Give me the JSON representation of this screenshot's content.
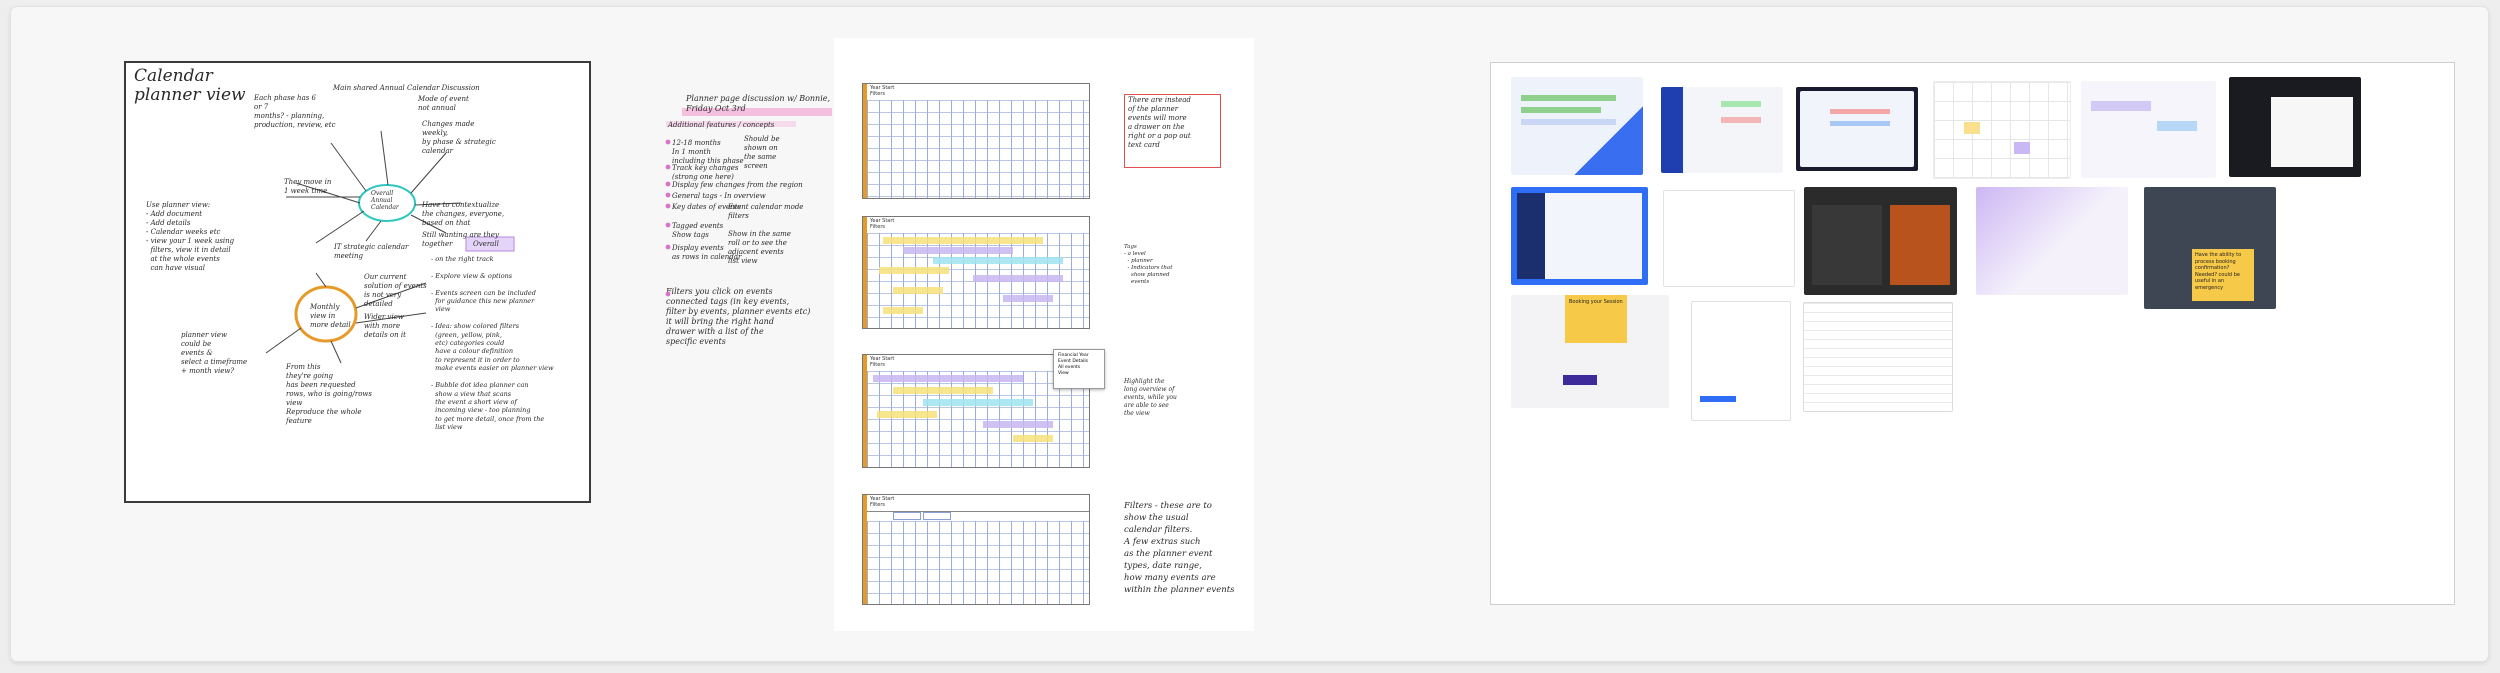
{
  "card1": {
    "title": "Calendar\nplanner view",
    "notes": [
      "Main shared Annual Calendar Discussion",
      "Each phase has 6\nor 7\nmonths? - planning,\nproduction, review, etc",
      "Mode of event\nnot annual",
      "Changes made\nweekly,\nby phase & strategic\ncalendar",
      "They move in\n1 week time",
      "Have to contextualize\nthe changes, everyone,\nbased on that",
      "Still wanting are they\ntogether",
      "Overall\nAnnual\nCalendar",
      "Use planner view:\n- Add document\n- Add details\n- Calendar weeks etc\n- view your 1 week using\n  filters, view it in detail\n  at the whole events\n  can have visual",
      "IT strategic calendar\nmeeting",
      "Monthly\nview in\nmore detail",
      "Our current\nsolution of events\nis not very\ndetailed",
      "Wider view\nwith more\ndetails on it",
      "planner view\ncould be\nevents &\nselect a timeframe\n+ month view?",
      "From this\nthey're going\nhas been requested\nrows, who is going/rows\nview",
      "Reproduce the whole\nfeature",
      "Overall",
      "- on the right track\n\n- Explore view & options\n\n- Events screen can be included\n  for guidance this new planner\n  view\n\n- Idea: show colored filters\n  (green, yellow, pink,\n  etc) categories could\n  have a colour definition\n  to represent it in order to\n  make events easier on planner view\n\n- Bubble dot idea planner can\n  show a view that scans\n  the event a short view of\n  incoming view - too planning\n  to get more detail, once from the\n  list view"
    ]
  },
  "card2": {
    "top_notes": [
      "Planner page discussion w/ Bonnie,\nFriday Oct 3rd",
      "Additional features / concepts",
      "12-18 months\nIn 1 month\nincluding this phase",
      "Should be\nshown on\nthe same\nscreen",
      "Track key changes\n(strong one here)",
      "Display few changes from the region",
      "General tags - In overview",
      "Key dates of events",
      "Event calendar mode\nfilters",
      "Tagged events\nShow tags",
      "Display events\nas rows in calendar",
      "Show in the same\nroll or to see the\nadjacent events\nlist view",
      "Filters you click on events\nconnected tags (in key events,\nfilter by events, planner events etc)\nit will bring the right hand\ndrawer with a list of the\nspecific events"
    ],
    "frame_label": "Year Start\nFilters",
    "side_notes": [
      "There are instead\nof the planner\nevents will more\na drawer on the\nright or a pop out\ntext card",
      "Tags\n- a level\n  - planner\n  - Indicators that\n    show planned\n    events",
      "Highlight the\nlong overview of\nevents, while you\nare able to see\nthe view",
      "Filters - these are to\nshow the usual\ncalendar filters.\nA few extras such\nas the planner event\ntypes, date range,\nhow many events are\nwithin the planner events"
    ],
    "popup": "Financial Year\nEvent Details\nAll events\nView"
  },
  "card3": {
    "thumbs": [
      "dashboard-schedule-light",
      "dark-sidebar-list-app",
      "task-board-dark-frame",
      "monthly-calendar-grid",
      "calendar-week-view",
      "dark-settings-panel",
      "blue-sidebar-calendar",
      "schedule-table-app",
      "orange-dark-booking",
      "purple-gradient-calendar",
      "dark-dashboard-sticky",
      "event-card-sticky",
      "mobile-list-form",
      "grey-data-table"
    ],
    "stickies": [
      "Booking your Session",
      "Have the ability to\nprocess booking\nconfirmation?\nNeeded? could be\nuseful in an\nemergency"
    ]
  },
  "colors": {
    "accent_orange": "#e69a2a",
    "event_yellow": "#f6e27a",
    "event_purple": "#c7b6f0",
    "event_cyan": "#9fe3ef",
    "highlight_pink": "#f3a6d6",
    "sticky_yellow": "#f7c948"
  }
}
